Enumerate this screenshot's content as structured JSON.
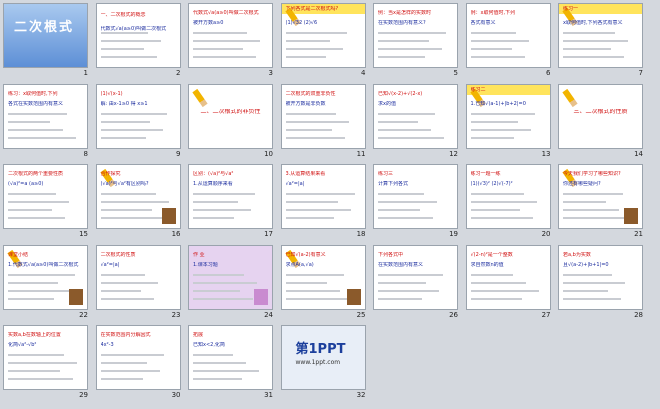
{
  "slides": [
    {
      "n": "1",
      "t1": "二次根式",
      "t2": ""
    },
    {
      "n": "2",
      "t1": "一、二次根式的概念",
      "t2": "代数式√a(a≥0)叫做二次根式"
    },
    {
      "n": "3",
      "t1": "代数式√a(a≥0)叫做二次根式",
      "t2": "被开方数a≥0"
    },
    {
      "n": "4",
      "t1": "下列各式是二次根式吗?",
      "t2": "(1)√32 (2)√6"
    },
    {
      "n": "5",
      "t1": "例：当x是怎样的实数时",
      "t2": "在实数范围内有意义?"
    },
    {
      "n": "6",
      "t1": "例：x取何值时,下列",
      "t2": "各式有意义"
    },
    {
      "n": "7",
      "t1": "练习一",
      "t2": "x取何值时,下列各式有意义"
    },
    {
      "n": "8",
      "t1": "练习：x取何值时,下列",
      "t2": "各式在实数范围内有意义"
    },
    {
      "n": "9",
      "t1": "(1)√(x-1)",
      "t2": "解: 由x-1≥0 得 x≥1"
    },
    {
      "n": "10",
      "t1": "二、二次根式的非负性",
      "t2": ""
    },
    {
      "n": "11",
      "t1": "二次根式的双重非负性",
      "t2": "被开方数是非负数"
    },
    {
      "n": "12",
      "t1": "已知√(x-2)+√(2-x)",
      "t2": "求x的值"
    },
    {
      "n": "13",
      "t1": "练习二",
      "t2": "1.已知√(a-1)+|b+2|=0"
    },
    {
      "n": "14",
      "t1": "三、二次根式的性质",
      "t2": ""
    },
    {
      "n": "15",
      "t1": "二次根式的两个重要性质",
      "t2": "(√a)²=a (a≥0)"
    },
    {
      "n": "16",
      "t1": "合作探究",
      "t2": "(√a)²与√a²有区别吗?"
    },
    {
      "n": "17",
      "t1": "区别：(√a)²与√a²",
      "t2": "1.从运算顺序来看"
    },
    {
      "n": "18",
      "t1": "3.从运算结果来看",
      "t2": "√a²=|a|"
    },
    {
      "n": "19",
      "t1": "练习三",
      "t2": "计算下列各式"
    },
    {
      "n": "20",
      "t1": "练习一题一练",
      "t2": "(1)(√3)² (2)√(-7)²"
    },
    {
      "n": "21",
      "t1": "今天我们学习了哪些知识?",
      "t2": "你还有哪些疑问?"
    },
    {
      "n": "22",
      "t1": "课堂小结",
      "t2": "1.代数式√a(a≥0)叫做二次根式"
    },
    {
      "n": "23",
      "t1": "二次根式的性质",
      "t2": "√a²=|a|"
    },
    {
      "n": "24",
      "t1": "作 业",
      "t2": "1.课本习题"
    },
    {
      "n": "25",
      "t1": "已知√(a-2)有意义",
      "t2": "求点A(a,√a)"
    },
    {
      "n": "26",
      "t1": "下列各式中",
      "t2": "在实数范围内有意义"
    },
    {
      "n": "27",
      "t1": "√(2-n)²是一个整数",
      "t2": "求自然数n的值"
    },
    {
      "n": "28",
      "t1": "若a,b为实数",
      "t2": "且√(a-2)+|b+1|=0"
    },
    {
      "n": "29",
      "t1": "实数a,b在数轴上的位置",
      "t2": "化简√a²-√b²"
    },
    {
      "n": "30",
      "t1": "在实数范围内分解因式",
      "t2": "4x²-3"
    },
    {
      "n": "31",
      "t1": "拓展",
      "t2": "已知x<2,化简"
    },
    {
      "n": "32",
      "t1": "第1PPT",
      "t2": "www.1ppt.com"
    }
  ]
}
